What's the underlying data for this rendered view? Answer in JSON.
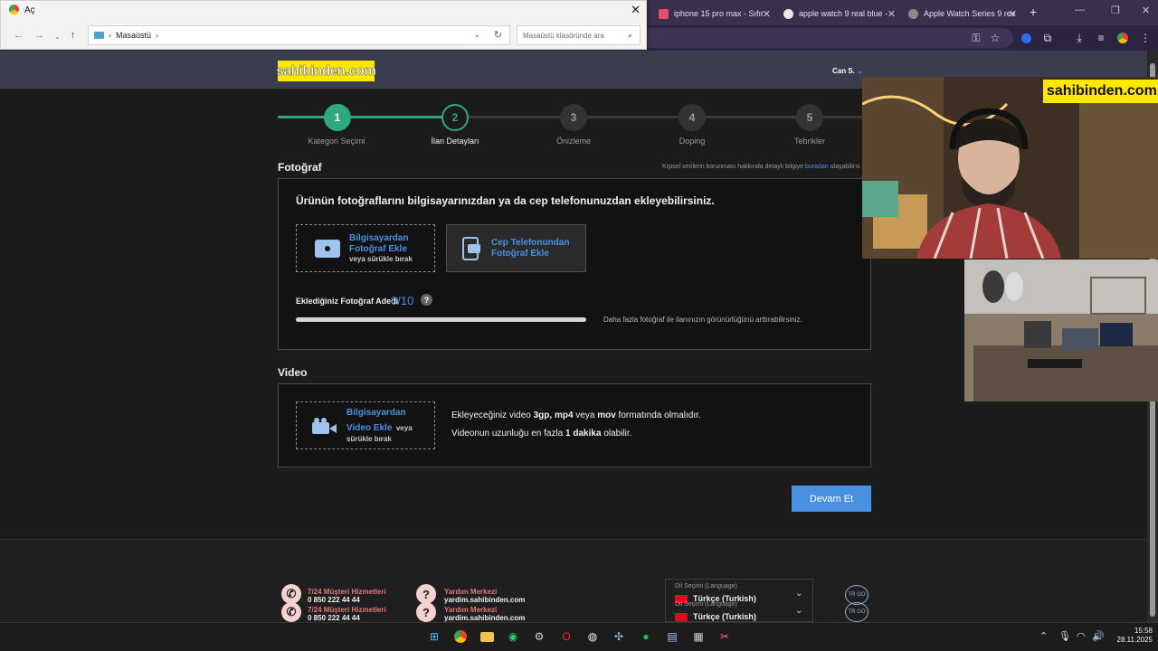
{
  "browser": {
    "tabs": [
      {
        "title": "iphone 15 pro max - Sıfır"
      },
      {
        "title": "apple watch 9 real blue -"
      },
      {
        "title": "Apple Watch Series 9 rev"
      }
    ]
  },
  "dialog": {
    "title": "Aç",
    "path": "Masaüstü",
    "search_placeholder": "Masaüstü klasöründe ara"
  },
  "header": {
    "logo": "sahibinden.com",
    "user": "Can S."
  },
  "steps": [
    {
      "num": "1",
      "label": "Kategori Seçimi",
      "state": "done"
    },
    {
      "num": "2",
      "label": "İlan Detayları",
      "state": "active"
    },
    {
      "num": "3",
      "label": "Önizleme",
      "state": "todo"
    },
    {
      "num": "4",
      "label": "Doping",
      "state": "todo"
    },
    {
      "num": "5",
      "label": "Tebrikler",
      "state": "todo"
    }
  ],
  "photo": {
    "title": "Fotoğraf",
    "privacy_pre": "Kişisel verilerin korunması hakkında detaylı bilgiye",
    "privacy_link": "buradan",
    "privacy_post": "ulaşabilirsi",
    "lead": "Ürünün fotoğraflarını bilgisayarınızdan ya da cep telefonunuzdan ekleyebilirsiniz.",
    "computer_line1": "Bilgisayardan",
    "computer_line2": "Fotoğraf Ekle",
    "computer_hint": "veya sürükle bırak",
    "phone_line1": "Cep Telefonundan",
    "phone_line2": "Fotoğraf Ekle",
    "count_label": "Eklediğiniz Fotoğraf Adedi",
    "count_value": "0/10",
    "count_progress": 0,
    "help": "?",
    "hint": "Daha fazla fotoğraf ile ilanınızın görünürlüğünü arttırabilirsiniz."
  },
  "video": {
    "title": "Video",
    "btn_line1": "Bilgisayardan",
    "btn_line2": "Video Ekle",
    "btn_hint_a": "veya",
    "btn_hint_b": "sürükle bırak",
    "info1_pre": "Ekleyeceğiniz video",
    "info1_fmt1": "3gp, mp4",
    "info1_mid": "veya",
    "info1_fmt2": "mov",
    "info1_post": "formatında olmalıdır.",
    "info2_pre": "Videonun uzunluğu en fazla",
    "info2_dur": "1 dakika",
    "info2_post": "olabilir."
  },
  "cta": "Devam Et",
  "footer": {
    "support_title": "7/24 Müşteri Hizmetleri",
    "support_phone": "0 850 222 44 44",
    "help_title": "Yardım Merkezi",
    "help_url": "yardim.sahibinden.com",
    "lang_label": "Dil Seçimi (Language)",
    "lang_value": "Türkçe (Turkish)",
    "trgo": "TR GO"
  },
  "overlay": {
    "tag": "sahibinden.com"
  },
  "taskbar": {
    "time": "15:58",
    "date": "28.11.2025"
  },
  "colors": {
    "accent": "#4a90e2",
    "step_done": "#2fa882",
    "brand_yellow": "#ffe800",
    "tab_bg": "#3a2f4d"
  }
}
